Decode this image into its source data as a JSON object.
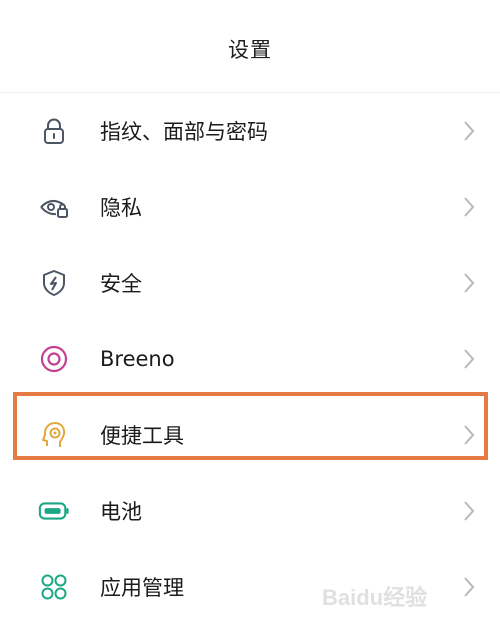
{
  "header": {
    "title": "设置"
  },
  "items": [
    {
      "label": "指纹、面部与密码",
      "icon": "lock-icon"
    },
    {
      "label": "隐私",
      "icon": "privacy-eye-icon"
    },
    {
      "label": "安全",
      "icon": "shield-icon"
    },
    {
      "label": "Breeno",
      "icon": "breeno-icon"
    },
    {
      "label": "便捷工具",
      "icon": "head-icon"
    },
    {
      "label": "电池",
      "icon": "battery-icon"
    },
    {
      "label": "应用管理",
      "icon": "apps-grid-icon"
    }
  ],
  "watermark": {
    "text": "Baidu经验"
  },
  "colors": {
    "icon_gray": "#4b5563",
    "breeno_purple": "#c4408f",
    "head_orange": "#e3a93a",
    "battery_green": "#1aa884",
    "highlight": "#e57a44"
  }
}
